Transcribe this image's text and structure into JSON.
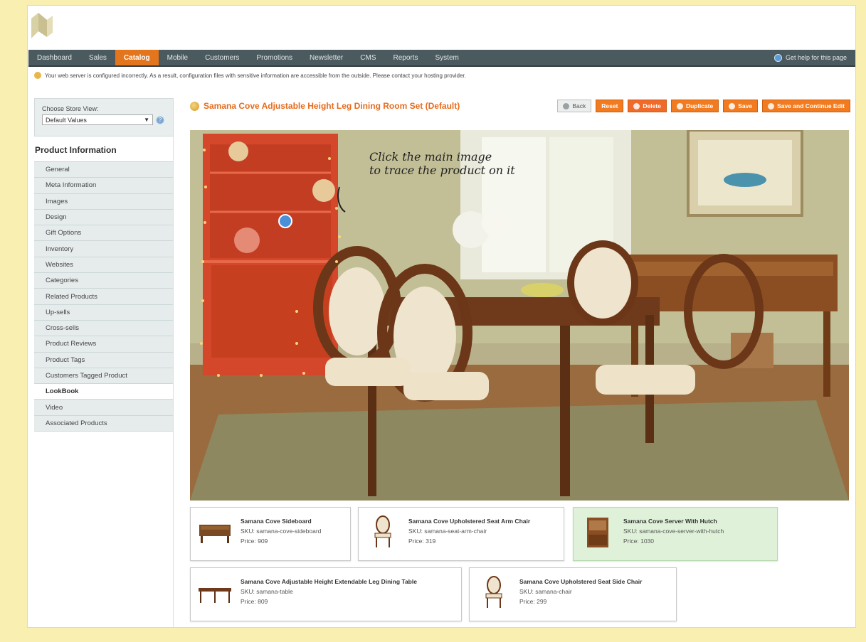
{
  "nav": {
    "items": [
      "Dashboard",
      "Sales",
      "Catalog",
      "Mobile",
      "Customers",
      "Promotions",
      "Newsletter",
      "CMS",
      "Reports",
      "System"
    ],
    "active_index": 2,
    "help": "Get help for this page"
  },
  "notice": "Your web server is configured incorrectly. As a result, configuration files with sensitive information are accessible from the outside. Please contact your hosting provider.",
  "sidebar": {
    "store_label": "Choose Store View:",
    "store_value": "Default Values",
    "section_title": "Product Information",
    "tabs": [
      "General",
      "Meta Information",
      "Images",
      "Design",
      "Gift Options",
      "Inventory",
      "Websites",
      "Categories",
      "Related Products",
      "Up-sells",
      "Cross-sells",
      "Product Reviews",
      "Product Tags",
      "Customers Tagged Product",
      "LookBook",
      "Video",
      "Associated Products"
    ],
    "active_tab_index": 14
  },
  "page": {
    "title": "Samana Cove Adjustable Height Leg Dining Room Set (Default)",
    "buttons": {
      "back": "Back",
      "reset": "Reset",
      "delete": "Delete",
      "duplicate": "Duplicate",
      "save": "Save",
      "save_continue": "Save and Continue Edit"
    }
  },
  "lookbook": {
    "tip_line1": "Click the main image",
    "tip_line2": "to trace the product on it"
  },
  "products": [
    {
      "name": "Samana Cove Sideboard",
      "sku": "SKU: samana-cove-sideboard",
      "price": "Price: 909",
      "thumb": "sideboard",
      "highlight": false
    },
    {
      "name": "Samana Cove Upholstered Seat Arm Chair",
      "sku": "SKU: samana-seat-arm-chair",
      "price": "Price: 319",
      "thumb": "chair",
      "highlight": false
    },
    {
      "name": "Samana Cove Server With Hutch",
      "sku": "SKU: samana-cove-server-with-hutch",
      "price": "Price: 1030",
      "thumb": "hutch",
      "highlight": true
    },
    {
      "name": "Samana Cove Adjustable Height Extendable Leg Dining Table",
      "sku": "SKU: samana-table",
      "price": "Price: 809",
      "thumb": "table",
      "highlight": false
    },
    {
      "name": "Samana Cove Upholstered Seat Side Chair",
      "sku": "SKU: samana-chair",
      "price": "Price: 299",
      "thumb": "chair",
      "highlight": false
    }
  ],
  "colors": {
    "accent": "#e3751d",
    "nav_bg": "#4b5a5f",
    "page_bg": "#f9efb0",
    "highlight_card": "#dff2d9"
  }
}
